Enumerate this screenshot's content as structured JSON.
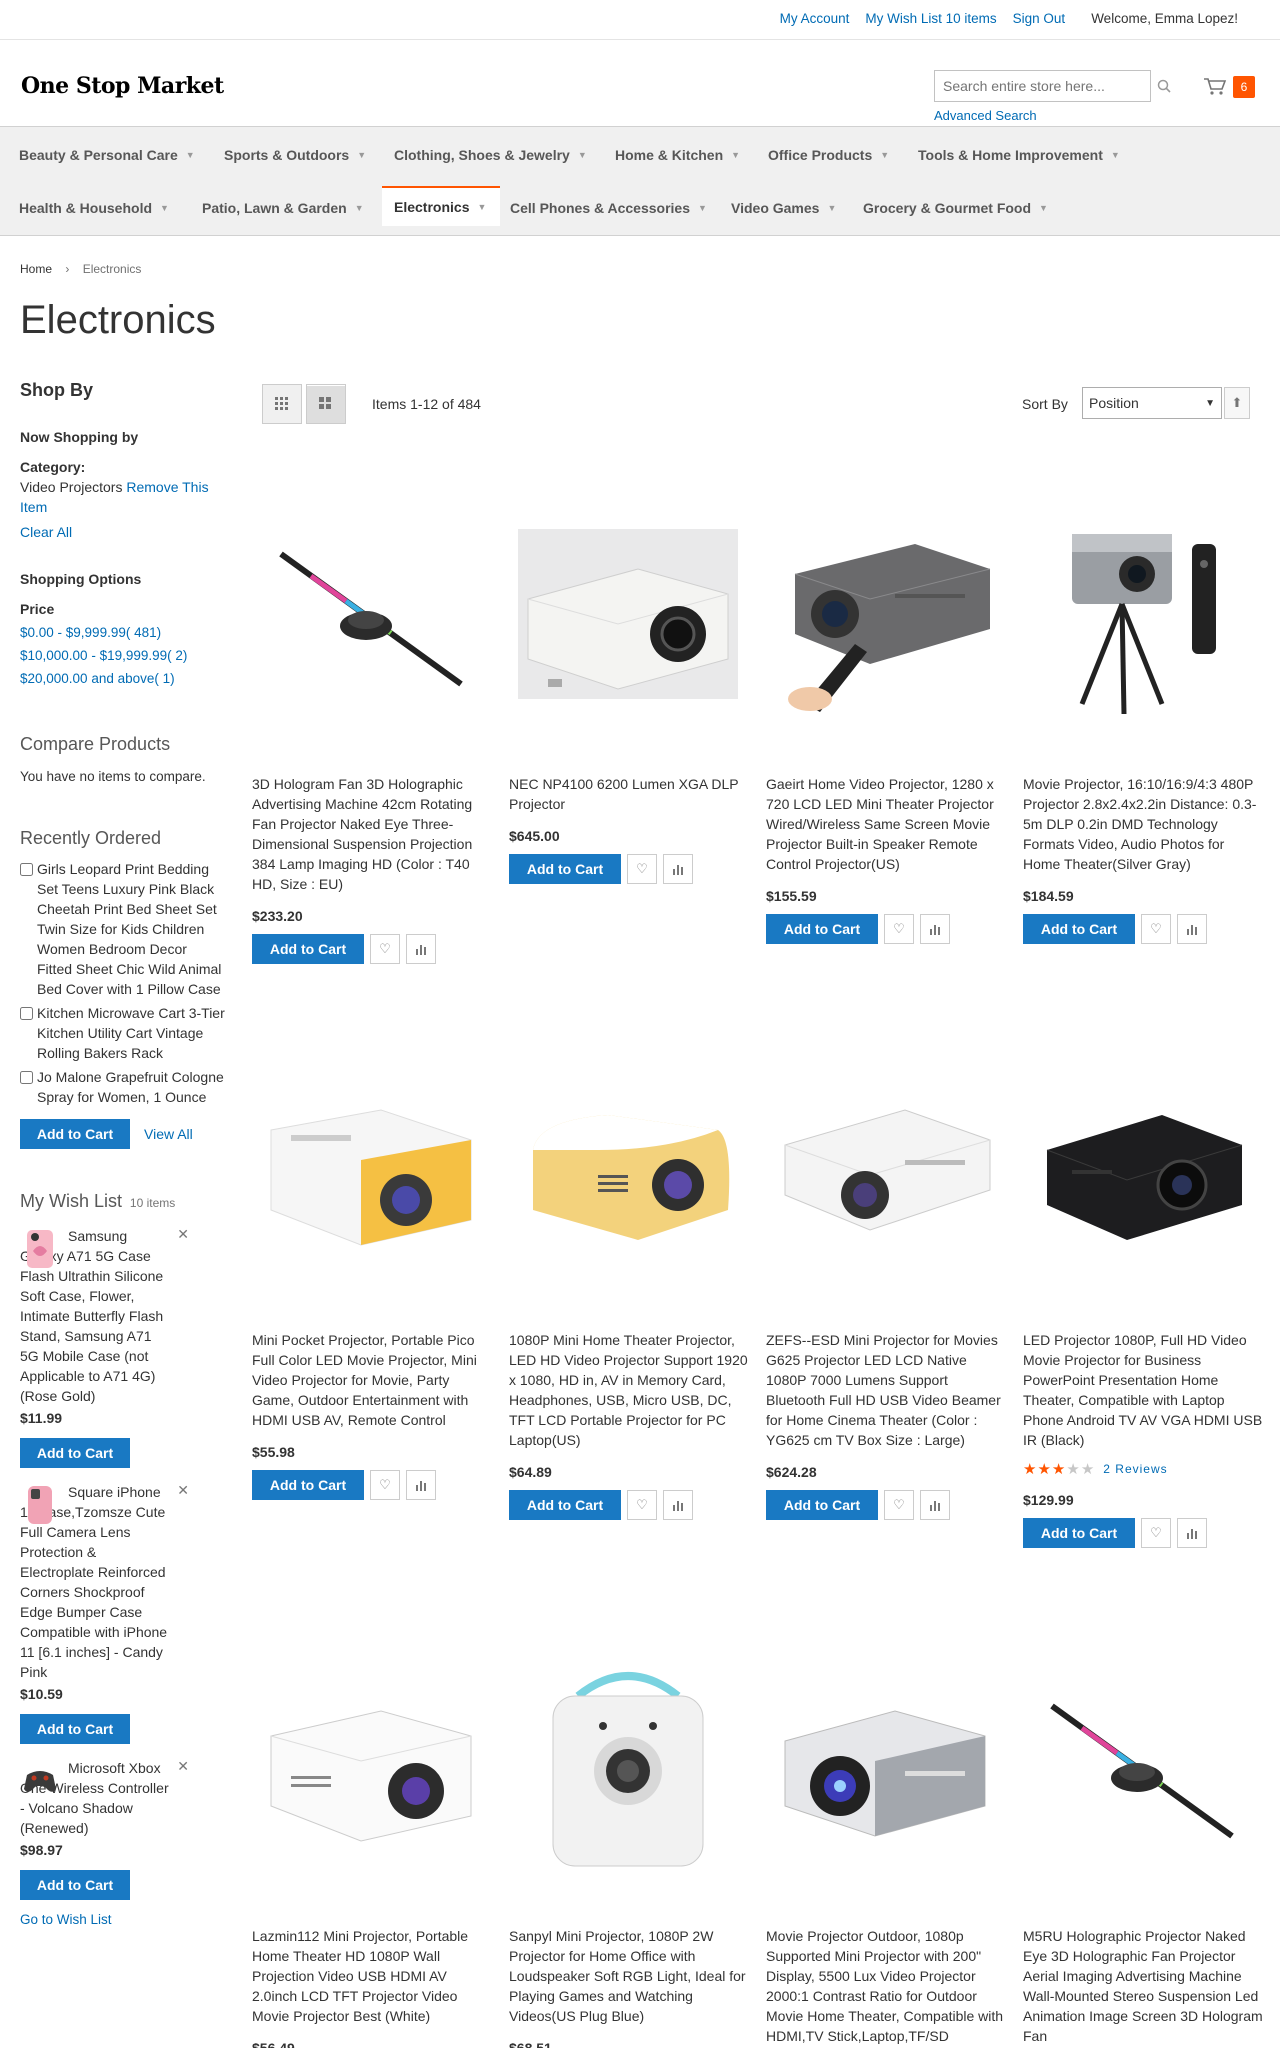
{
  "top_links": {
    "account": "My Account",
    "wishlist": "My Wish List 10 items",
    "signout": "Sign Out",
    "welcome": "Welcome, Emma Lopez!"
  },
  "header": {
    "logo": "One Stop Market",
    "search_placeholder": "Search entire store here...",
    "advanced_search": "Advanced Search",
    "cart_count": "6"
  },
  "nav": [
    {
      "label": "Beauty & Personal Care"
    },
    {
      "label": "Sports & Outdoors"
    },
    {
      "label": "Clothing, Shoes & Jewelry"
    },
    {
      "label": "Home & Kitchen"
    },
    {
      "label": "Office Products"
    },
    {
      "label": "Tools & Home Improvement"
    },
    {
      "label": "Health & Household"
    },
    {
      "label": "Patio, Lawn & Garden"
    },
    {
      "label": "Electronics"
    },
    {
      "label": "Cell Phones & Accessories"
    },
    {
      "label": "Video Games"
    },
    {
      "label": "Grocery & Gourmet Food"
    }
  ],
  "breadcrumb": {
    "home": "Home",
    "current": "Electronics"
  },
  "page_title": "Electronics",
  "sidebar": {
    "shop_by": "Shop By",
    "now_shopping": "Now Shopping by",
    "filter_label": "Category:",
    "filter_value": "Video Projectors",
    "remove": "Remove This Item",
    "clear_all": "Clear All",
    "shopping_options": "Shopping Options",
    "price_label": "Price",
    "price_ranges": [
      {
        "range": "$0.00 - $9,999.99",
        "count": "( 481)"
      },
      {
        "range": "$10,000.00 - $19,999.99",
        "count": "( 2)"
      },
      {
        "range": "$20,000.00 and above",
        "count": "( 1)"
      }
    ],
    "compare_title": "Compare Products",
    "compare_text": "You have no items to compare.",
    "recent_title": "Recently Ordered",
    "recent_items": [
      "Girls Leopard Print Bedding Set Teens Luxury Pink Black Cheetah Print Bed Sheet Set Twin Size for Kids Children Women Bedroom Decor Fitted Sheet Chic Wild Animal Bed Cover with 1 Pillow Case",
      "Kitchen Microwave Cart 3-Tier Kitchen Utility Cart Vintage Rolling Bakers Rack",
      "Jo Malone Grapefruit Cologne Spray for Women, 1 Ounce"
    ],
    "add_to_cart": "Add to Cart",
    "view_all": "View All",
    "wish_title": "My Wish List",
    "wish_count": "10 items",
    "wish_items": [
      {
        "name": "Samsung Galaxy A71 5G Case Flash Ultrathin Silicone Soft Case, Flower, Intimate Butterfly Flash Stand, Samsung A71 5G Mobile Case (not Applicable to A71 4G) (Rose Gold)",
        "price": "$11.99"
      },
      {
        "name": "Square iPhone 11 Case,Tzomsze Cute Full Camera Lens Protection & Electroplate Reinforced Corners Shockproof Edge Bumper Case Compatible with iPhone 11 [6.1 inches] - Candy Pink",
        "price": "$10.59"
      },
      {
        "name": "Microsoft Xbox One Wireless Controller - Volcano Shadow (Renewed)",
        "price": "$98.97"
      }
    ],
    "go_to_wishlist": "Go to Wish List"
  },
  "toolbar": {
    "amount": "Items 1-12 of 484",
    "sort_label": "Sort By",
    "sort_value": "Position"
  },
  "products": [
    {
      "name": "3D Hologram Fan 3D Holographic Advertising Machine 42cm Rotating Fan Projector Naked Eye Three-Dimensional Suspension Projection 384 Lamp Imaging HD (Color : T40 HD, Size : EU)",
      "price": "$233.20",
      "img": "hologram"
    },
    {
      "name": "NEC NP4100 6200 Lumen XGA DLP Projector",
      "price": "$645.00",
      "img": "nec"
    },
    {
      "name": "Gaeirt Home Video Projector, 1280 x 720 LCD LED Mini Theater Projector Wired/Wireless Same Screen Movie Projector Built-in Speaker Remote Control Projector(US)",
      "price": "$155.59",
      "img": "gray-remote"
    },
    {
      "name": "Movie Projector, 16:10/16:9/4:3 480P Projector 2.8x2.4x2.2in Distance: 0.3-5m DLP 0.2in DMD Technology Formats Video, Audio Photos for Home Theater(Silver Gray)",
      "price": "$184.59",
      "img": "tripod"
    },
    {
      "name": "Mini Pocket Projector, Portable Pico Full Color LED Movie Projector, Mini Video Projector for Movie, Party Game, Outdoor Entertainment with HDMI USB AV, Remote Control",
      "price": "$55.98",
      "img": "yellow1"
    },
    {
      "name": "1080P Mini Home Theater Projector, LED HD Video Projector Support 1920 x 1080, HD in, AV in Memory Card, Headphones, USB, Micro USB, DC, TFT LCD Portable Projector for PC Laptop(US)",
      "price": "$64.89",
      "img": "yellow2"
    },
    {
      "name": "ZEFS--ESD Mini Projector for Movies G625 Projector LED LCD Native 1080P 7000 Lumens Support Bluetooth Full HD USB Video Beamer for Home Cinema Theater (Color : YG625 cm TV Box Size : Large)",
      "price": "$624.28",
      "img": "white-flat"
    },
    {
      "name": "LED Projector 1080P, Full HD Video Movie Projector for Business PowerPoint Presentation Home Theater, Compatible with Laptop Phone Android TV AV VGA HDMI USB IR (Black)",
      "price": "$129.99",
      "img": "black",
      "rating_text": "2  Reviews"
    },
    {
      "name": "Lazmin112 Mini Projector, Portable Home Theater HD 1080P Wall Projection Video USB HDMI AV 2.0inch LCD TFT Projector Video Movie Projector Best (White)",
      "price": "$56.49",
      "img": "white-small"
    },
    {
      "name": "Sanpyl Mini Projector, 1080P 2W Projector for Home Office with Loudspeaker Soft RGB Light, Ideal for Playing Games and Watching Videos(US Plug Blue)",
      "price": "$68.51",
      "img": "cube"
    },
    {
      "name": "Movie Projector Outdoor, 1080p Supported Mini Projector with 200\" Display, 5500 Lux Video Projector 2000:1 Contrast Ratio for Outdoor Movie Home Theater, Compatible with HDMI,TV Stick,Laptop,TF/SD",
      "price": "",
      "img": "bonsai"
    },
    {
      "name": "M5RU Holographic Projector Naked Eye 3D Holographic Fan Projector Aerial Imaging Advertising Machine Wall-Mounted Stereo Suspension Led Animation Image Screen 3D Hologram Fan",
      "price": "",
      "img": "hologram"
    }
  ],
  "product_labels": {
    "add_to_cart": "Add to Cart"
  },
  "colors": {
    "accent": "#1979c3",
    "cart_badge": "#ff5501",
    "rating": "#ff5501"
  },
  "rating": {
    "stars": 3,
    "out_of": 5
  }
}
